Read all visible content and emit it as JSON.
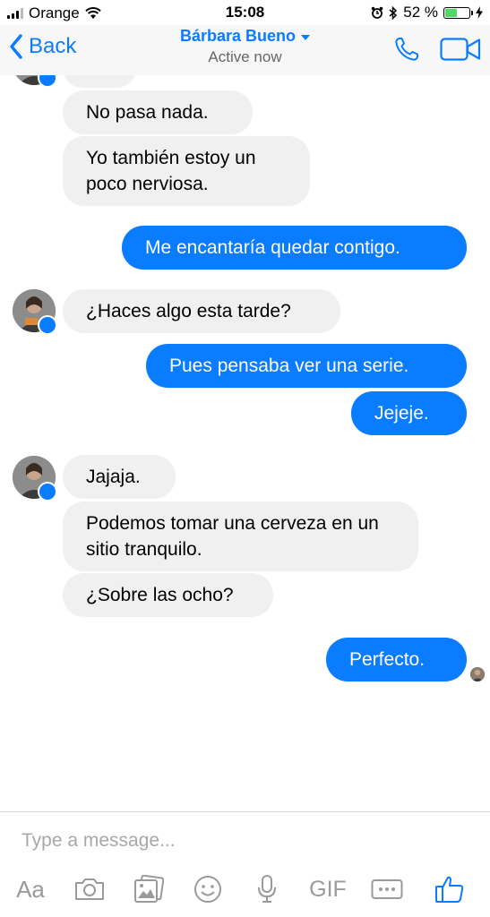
{
  "statusbar": {
    "carrier": "Orange",
    "time": "15:08",
    "battery": "52 %",
    "battery_level": 0.52
  },
  "header": {
    "back_label": "Back",
    "contact_name": "Bárbara Bueno",
    "contact_status": "Active now"
  },
  "messages": [
    {
      "side": "in",
      "text": "No pasa nada."
    },
    {
      "side": "in",
      "text": "Yo también estoy un poco nerviosa."
    },
    {
      "side": "out",
      "text": "Me encantaría quedar contigo."
    },
    {
      "side": "in",
      "text": "¿Haces algo esta tarde?"
    },
    {
      "side": "out",
      "text": "Pues pensaba ver una serie."
    },
    {
      "side": "out",
      "text": "Jejeje."
    },
    {
      "side": "in",
      "text": "Jajaja."
    },
    {
      "side": "in",
      "text": "Podemos tomar una cerveza en un sitio tranquilo."
    },
    {
      "side": "in",
      "text": "¿Sobre las ocho?"
    },
    {
      "side": "out",
      "text": "Perfecto."
    }
  ],
  "composer": {
    "placeholder": "Type a message...",
    "aa_label": "Aa",
    "gif_label": "GIF"
  },
  "colors": {
    "accent": "#0a7cff",
    "incoming_bubble": "#f1f0f0",
    "outgoing_bubble": "#0a7cff"
  },
  "icons": [
    "wifi-icon",
    "alarm-icon",
    "bluetooth-icon",
    "phone-icon",
    "video-icon",
    "messenger-badge-icon",
    "camera-icon",
    "gallery-icon",
    "emoji-icon",
    "microphone-icon",
    "more-icon",
    "thumbs-up-icon"
  ]
}
